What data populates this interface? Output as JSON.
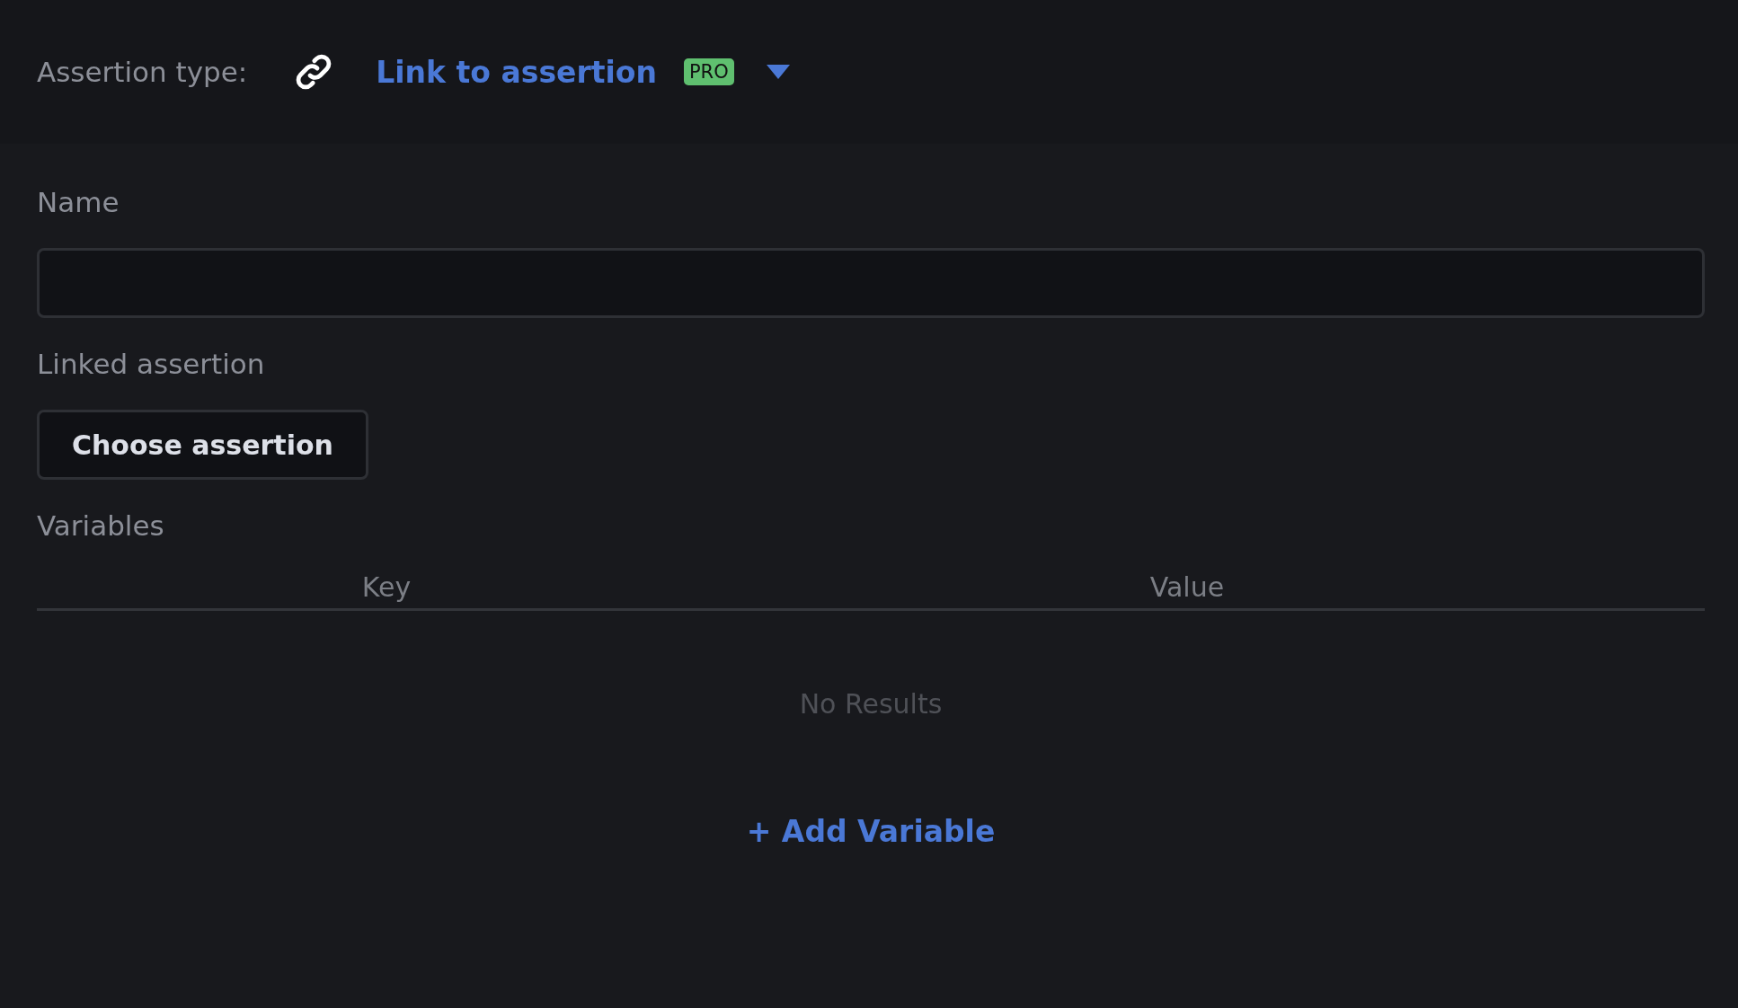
{
  "assertion_type": {
    "label": "Assertion type:",
    "value": "Link to assertion",
    "badge": "PRO"
  },
  "name_field": {
    "label": "Name"
  },
  "linked_assertion": {
    "label": "Linked assertion",
    "button": "Choose assertion"
  },
  "variables": {
    "label": "Variables",
    "columns": [
      "Key",
      "Value"
    ],
    "empty_text": "No Results",
    "add_button": "+ Add Variable"
  }
}
